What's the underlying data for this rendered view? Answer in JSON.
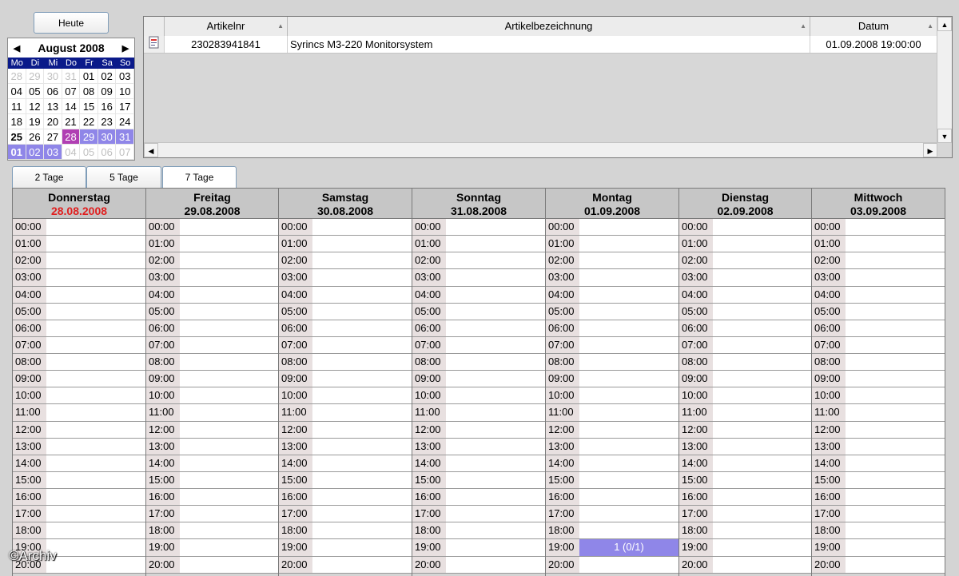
{
  "heute_label": "Heute",
  "mini_calendar": {
    "month_label": "August 2008",
    "weekdays": [
      "Mo",
      "Di",
      "Mi",
      "Do",
      "Fr",
      "Sa",
      "So"
    ],
    "days": [
      {
        "d": "28",
        "out": true
      },
      {
        "d": "29",
        "out": true
      },
      {
        "d": "30",
        "out": true
      },
      {
        "d": "31",
        "out": true
      },
      {
        "d": "01"
      },
      {
        "d": "02"
      },
      {
        "d": "03"
      },
      {
        "d": "04"
      },
      {
        "d": "05"
      },
      {
        "d": "06"
      },
      {
        "d": "07"
      },
      {
        "d": "08"
      },
      {
        "d": "09"
      },
      {
        "d": "10"
      },
      {
        "d": "11"
      },
      {
        "d": "12"
      },
      {
        "d": "13"
      },
      {
        "d": "14"
      },
      {
        "d": "15"
      },
      {
        "d": "16"
      },
      {
        "d": "17"
      },
      {
        "d": "18"
      },
      {
        "d": "19"
      },
      {
        "d": "20"
      },
      {
        "d": "21"
      },
      {
        "d": "22"
      },
      {
        "d": "23"
      },
      {
        "d": "24"
      },
      {
        "d": "25",
        "bold": true
      },
      {
        "d": "26"
      },
      {
        "d": "27"
      },
      {
        "d": "28",
        "today": true
      },
      {
        "d": "29",
        "sel": true
      },
      {
        "d": "30",
        "sel": true
      },
      {
        "d": "31",
        "sel": true
      },
      {
        "d": "01",
        "sel": true,
        "bold": true
      },
      {
        "d": "02",
        "sel": true
      },
      {
        "d": "03",
        "sel": true
      },
      {
        "d": "04",
        "out": true
      },
      {
        "d": "05",
        "out": true
      },
      {
        "d": "06",
        "out": true
      },
      {
        "d": "07",
        "out": true
      }
    ]
  },
  "articles": {
    "columns": [
      "Artikelnr",
      "Artikelbezeichnung",
      "Datum"
    ],
    "rows": [
      {
        "artikelnr": "230283941841",
        "bezeichnung": "Syrincs M3-220 Monitorsystem",
        "datum": "01.09.2008 19:00:00"
      }
    ]
  },
  "tabs": [
    "2 Tage",
    "5 Tage",
    "7 Tage"
  ],
  "week": {
    "days": [
      {
        "name": "Donnerstag",
        "date": "28.08.2008",
        "today": true
      },
      {
        "name": "Freitag",
        "date": "29.08.2008"
      },
      {
        "name": "Samstag",
        "date": "30.08.2008"
      },
      {
        "name": "Sonntag",
        "date": "31.08.2008"
      },
      {
        "name": "Montag",
        "date": "01.09.2008"
      },
      {
        "name": "Dienstag",
        "date": "02.09.2008"
      },
      {
        "name": "Mittwoch",
        "date": "03.09.2008"
      }
    ],
    "times": [
      "00:00",
      "01:00",
      "02:00",
      "03:00",
      "04:00",
      "05:00",
      "06:00",
      "07:00",
      "08:00",
      "09:00",
      "10:00",
      "11:00",
      "12:00",
      "13:00",
      "14:00",
      "15:00",
      "16:00",
      "17:00",
      "18:00",
      "19:00",
      "20:00"
    ],
    "appointment": {
      "day_index": 4,
      "time": "19:00",
      "label": "1 (0/1)"
    }
  },
  "watermark": "©Archiv",
  "colors": {
    "selected": "#8f86e8",
    "today": "#b03fb3",
    "today_date_text": "#e02020",
    "weekday_bar": "#0a1a8a"
  }
}
